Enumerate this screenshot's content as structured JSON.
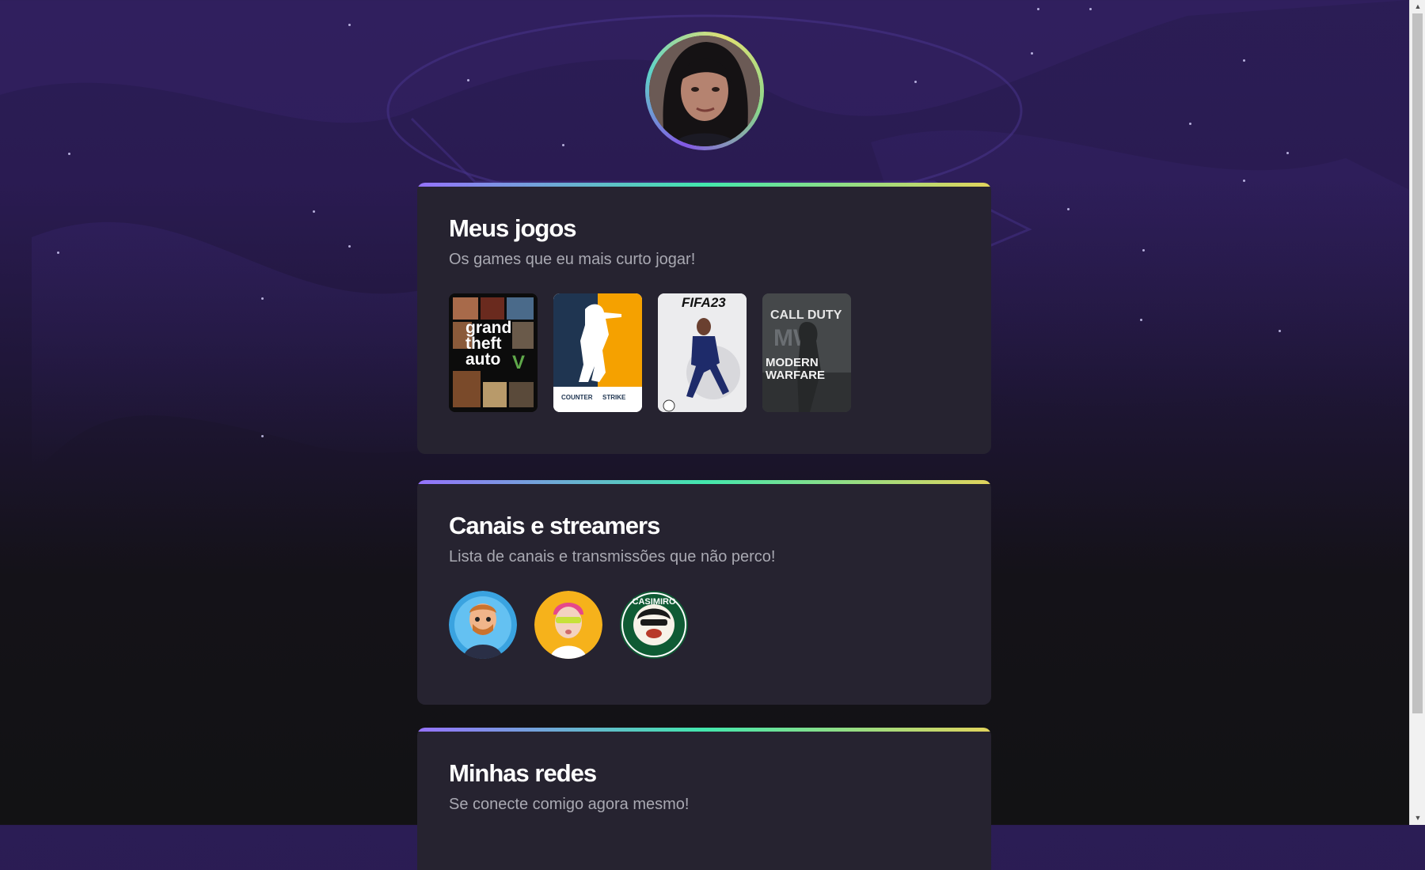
{
  "profile": {
    "avatar_icon": "user-photo-icon"
  },
  "games_card": {
    "title": "Meus jogos",
    "subtitle": "Os games que eu mais curto jogar!",
    "games": [
      {
        "icon": "gta-v-cover-icon",
        "cover_text": [
          "grand",
          "theft",
          "auto"
        ],
        "badge": "V"
      },
      {
        "icon": "counter-strike-cover-icon",
        "cover_text": [
          "COUNTER",
          "STRIKE"
        ]
      },
      {
        "icon": "fifa-23-cover-icon",
        "cover_text": [
          "FIFA23"
        ]
      },
      {
        "icon": "call-of-duty-cover-icon",
        "cover_text": [
          "CALL DUTY",
          "MW",
          "MODERN",
          "WARFARE"
        ]
      }
    ]
  },
  "streamers_card": {
    "title": "Canais e streamers",
    "subtitle": "Lista de canais e transmissões que não perco!",
    "streamers": [
      {
        "icon": "streamer-avatar-blue-icon"
      },
      {
        "icon": "streamer-avatar-yellow-icon"
      },
      {
        "icon": "casimiro-logo-icon",
        "ring_text": "CASIMIRO"
      }
    ]
  },
  "networks_card": {
    "title": "Minhas redes",
    "subtitle": "Se conecte comigo agora mesmo!"
  },
  "colors": {
    "card_bg": "#262330",
    "accent_gradient": [
      "#9572fc",
      "#43e7ad",
      "#e2d45c"
    ],
    "page_top": "#2b1d55",
    "page_bottom": "#121214"
  }
}
